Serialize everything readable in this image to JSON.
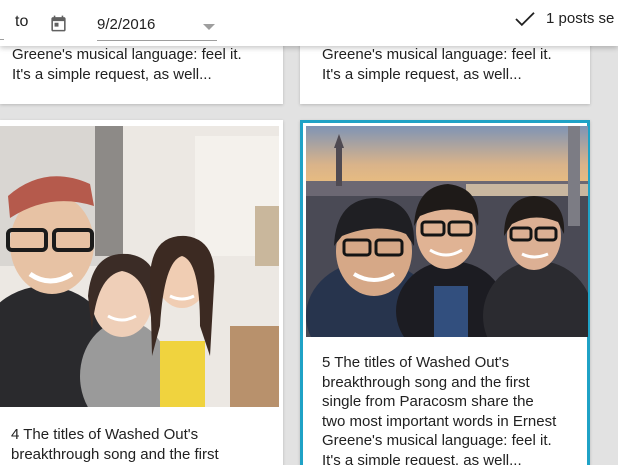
{
  "filter_bar": {
    "to_label": "to",
    "end_date": "9/2/2016",
    "selection_status": "1 posts se"
  },
  "posts": [
    {
      "excerpt": "Greene's musical language: feel it.\nIt's a simple request, as well...",
      "selected": false,
      "has_image": false
    },
    {
      "excerpt": "Greene's musical language: feel it.\nIt's a simple request, as well...",
      "selected": false,
      "has_image": false
    },
    {
      "excerpt": "4 The titles of Washed Out's\nbreakthrough song and the first",
      "selected": false,
      "has_image": true,
      "image": "selfie-three-friends-indoors"
    },
    {
      "excerpt": "5 The titles of Washed Out's\nbreakthrough song and the first\nsingle from Paracosm share the\ntwo most important words in Ernest\nGreene's musical language: feel it.\nIt's a simple request, as well...",
      "selected": true,
      "has_image": true,
      "image": "selfie-three-friends-rooftop-sunset"
    }
  ],
  "colors": {
    "background": "#e2e2e2",
    "card": "#ffffff",
    "selected_border": "#1fa2c6",
    "text": "#212121",
    "field_underline": "#9e9e9e"
  },
  "icons": {
    "calendar": "calendar-icon",
    "dropdown": "dropdown-arrow-icon",
    "check": "check-icon"
  }
}
